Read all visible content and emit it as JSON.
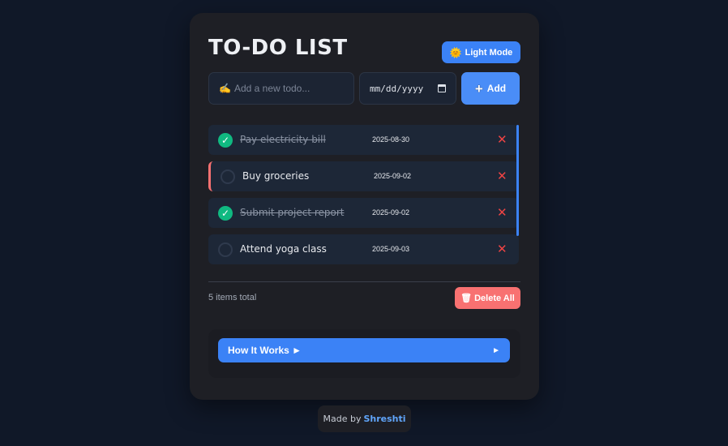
{
  "app": {
    "title": "TO-DO LIST",
    "mode_toggle": {
      "icon": "sun-icon",
      "label": "Light Mode"
    }
  },
  "input": {
    "icon": "writing-hand-icon",
    "placeholder": "Add a new todo...",
    "date_placeholder": "mm/dd/yyyy",
    "add_label": "Add"
  },
  "todos": [
    {
      "text": "Pay electricity bill",
      "date": "2025-08-30",
      "done": true
    },
    {
      "text": "Buy groceries",
      "date": "2025-09-02",
      "done": false
    },
    {
      "text": "Submit project report",
      "date": "2025-09-02",
      "done": true
    },
    {
      "text": "Attend yoga class",
      "date": "2025-09-03",
      "done": false
    }
  ],
  "summary": {
    "count_text": "5 items total",
    "delete_all_label": "Delete All"
  },
  "how_it_works": {
    "label": "How It Works ►",
    "arrow": "►"
  },
  "footer": {
    "prefix": "Made by",
    "author": "Shreshti"
  },
  "colors": {
    "accent": "#3b82f6",
    "danger": "#f87171",
    "success": "#10b981",
    "background": "#101828",
    "card": "#1e1f25"
  }
}
